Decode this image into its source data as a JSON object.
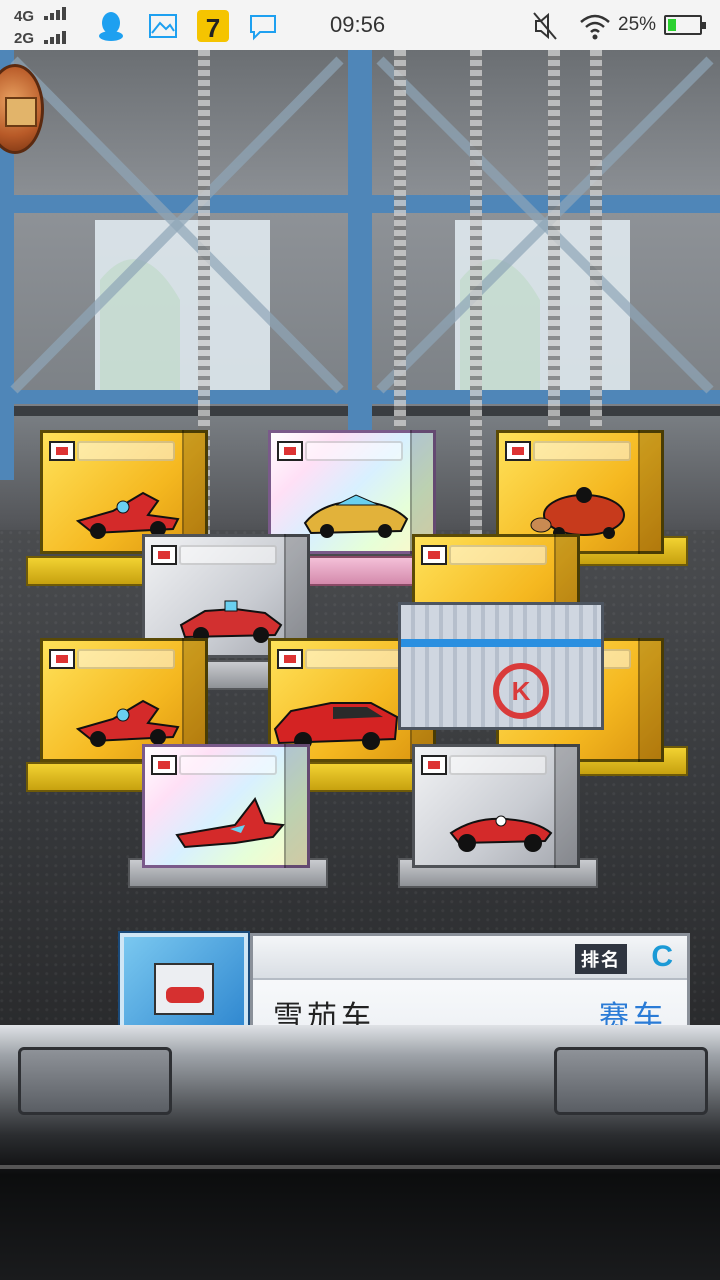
{
  "status_bar": {
    "network_1": "4G",
    "network_2": "2G",
    "time": "09:56",
    "battery_percent": "25%",
    "battery_level": 0.25,
    "icons": [
      "qq-icon",
      "image-icon",
      "app-7-icon",
      "chat-icon",
      "mute-icon",
      "wifi-icon"
    ]
  },
  "scene": {
    "boxes": [
      {
        "style": "gold",
        "car": "race-car-icon"
      },
      {
        "style": "rainbow",
        "car": "sports-car-icon"
      },
      {
        "style": "gold",
        "car": "turtle-car-icon"
      },
      {
        "style": "silver",
        "car": "roadster-icon"
      },
      {
        "style": "gold",
        "car": "race-car-icon"
      },
      {
        "style": "gold",
        "car": "race-car-icon"
      },
      {
        "style": "gold",
        "car": "red-suv-icon"
      },
      {
        "style": "container",
        "car": "shipping-container-icon"
      },
      {
        "style": "rainbow",
        "car": "jet-car-icon"
      },
      {
        "style": "silver",
        "car": "cigar-car-icon"
      }
    ]
  },
  "info_panel": {
    "rank_label": "排名",
    "rank_value": "C",
    "car_name": "雪茄车",
    "car_category": "赛车"
  },
  "colors": {
    "accent_blue": "#2a7bd6",
    "rank_cyan": "#1b9ad6"
  }
}
